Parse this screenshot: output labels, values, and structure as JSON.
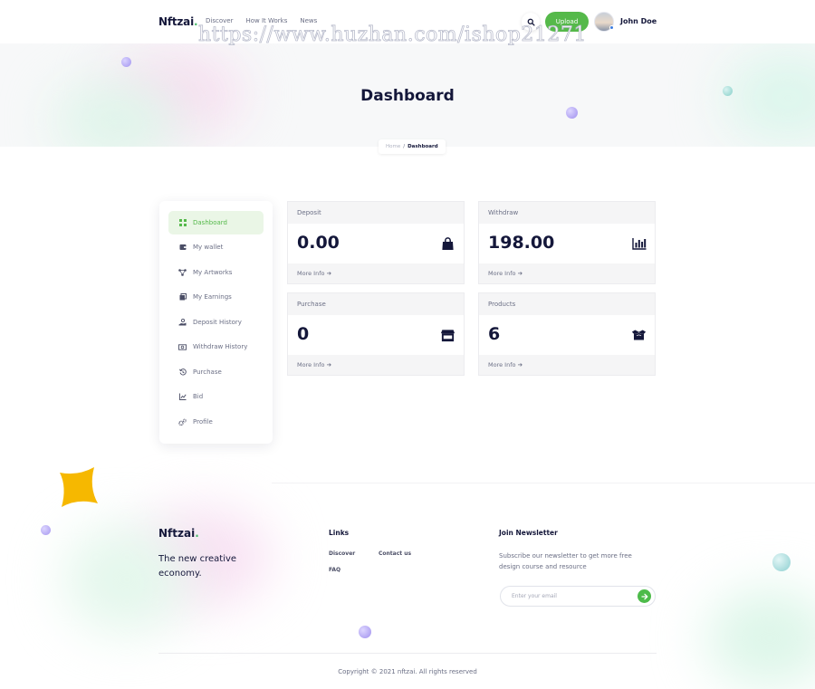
{
  "header": {
    "logo": "Nftzai",
    "logo_dot": ".",
    "nav": [
      "Discover",
      "How It Works",
      "News"
    ],
    "upload_label": "Upload",
    "user_name": "John Doe",
    "search_icon": "search-icon",
    "brand_color": "#55b94a"
  },
  "watermark": "https://www.huzhan.com/ishop21271",
  "hero": {
    "title": "Dashboard",
    "breadcrumb": {
      "home": "Home",
      "separator": "/",
      "current": "Dashboard"
    }
  },
  "sidebar": {
    "items": [
      {
        "label": "Dashboard",
        "icon": "grid-icon",
        "active": true
      },
      {
        "label": "My wallet",
        "icon": "wallet-icon",
        "active": false
      },
      {
        "label": "My Artworks",
        "icon": "network-icon",
        "active": false
      },
      {
        "label": "My Earnings",
        "icon": "copy-icon",
        "active": false
      },
      {
        "label": "Deposit History",
        "icon": "hand-coin-icon",
        "active": false
      },
      {
        "label": "Withdraw History",
        "icon": "money-icon",
        "active": false
      },
      {
        "label": "Purchase",
        "icon": "history-icon",
        "active": false
      },
      {
        "label": "Bid",
        "icon": "chart-icon",
        "active": false
      },
      {
        "label": "Profile",
        "icon": "gears-icon",
        "active": false
      }
    ]
  },
  "cards": [
    {
      "label": "Deposit",
      "value": "0.00",
      "more": "More Info",
      "icon": "shopping-bag-icon"
    },
    {
      "label": "Withdraw",
      "value": "198.00",
      "more": "More Info",
      "icon": "bar-chart-icon"
    },
    {
      "label": "Purchase",
      "value": "0",
      "more": "More Info",
      "icon": "store-icon"
    },
    {
      "label": "Products",
      "value": "6",
      "more": "More Info",
      "icon": "open-box-icon"
    }
  ],
  "footer": {
    "logo": "Nftzai",
    "logo_dot": ".",
    "tagline": "The new creative economy.",
    "links_heading": "Links",
    "links": [
      "Discover",
      "Contact us",
      "FAQ"
    ],
    "newsletter_heading": "Join Newsletter",
    "newsletter_desc": "Subscribe our newsletter to get more free design course and resource",
    "email_placeholder": "Enter your email",
    "copyright": "Copyright © 2021 nftzai. All rights reserved"
  }
}
